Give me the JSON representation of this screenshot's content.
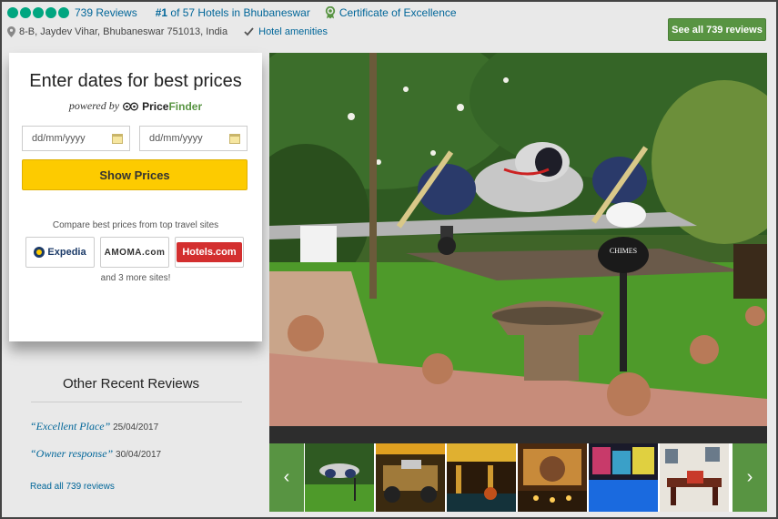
{
  "header": {
    "rating_bubbles": 5,
    "reviews_count": "739 Reviews",
    "rank_prefix": "#1",
    "rank_suffix": " of 57 Hotels in Bhubaneswar",
    "certificate": "Certificate of Excellence",
    "address": "8-B, Jaydev Vihar, Bhubaneswar 751013, India",
    "amenities": "Hotel amenities",
    "see_all_button": "See all 739 reviews"
  },
  "price_panel": {
    "title": "Enter dates for best prices",
    "powered_by": "powered by",
    "brand_a": "Price",
    "brand_b": "Finder",
    "checkin_placeholder": "dd/mm/yyyy",
    "checkout_placeholder": "dd/mm/yyyy",
    "show_prices": "Show Prices",
    "compare_text": "Compare best prices from top travel sites",
    "partners": [
      "Expedia",
      "AMOMA.com",
      "Hotels.com"
    ],
    "more_sites": "and 3 more sites!"
  },
  "other_reviews": {
    "title": "Other Recent Reviews",
    "items": [
      {
        "quote": "“Excellent Place”",
        "date": "25/04/2017"
      },
      {
        "quote": "“Owner response”",
        "date": "30/04/2017"
      }
    ],
    "read_all": "Read all 739 reviews"
  },
  "gallery": {
    "main_sign": "CHIMES",
    "prev_icon": "‹",
    "next_icon": "›"
  },
  "colors": {
    "accent_green": "#589442",
    "bubble_green": "#00a680",
    "link_blue": "#069",
    "cta_yellow": "#fdcb00"
  }
}
